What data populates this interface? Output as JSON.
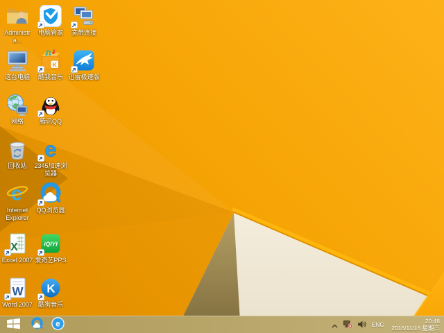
{
  "desktop": {
    "icons": [
      {
        "name": "user-folder",
        "label": "Administra...",
        "shortcut": false
      },
      {
        "name": "pc-manager",
        "label": "电脑管家",
        "shortcut": true
      },
      {
        "name": "broadband",
        "label": "宽带连接",
        "shortcut": true
      },
      {
        "name": "this-pc",
        "label": "这台电脑",
        "shortcut": false
      },
      {
        "name": "kuwo-music",
        "label": "酷我音乐",
        "shortcut": true
      },
      {
        "name": "xunlei",
        "label": "迅雷极速版",
        "shortcut": true
      },
      {
        "name": "network",
        "label": "网络",
        "shortcut": false
      },
      {
        "name": "tencent-qq",
        "label": "腾讯QQ",
        "shortcut": true
      },
      {
        "name": "recycle-bin",
        "label": "回收站",
        "shortcut": false
      },
      {
        "name": "2345-browser",
        "label": "2345加速浏\n览器",
        "shortcut": true
      },
      {
        "name": "internet-explorer",
        "label": "Internet\nExplorer",
        "shortcut": false
      },
      {
        "name": "qq-browser",
        "label": "QQ浏览器",
        "shortcut": true
      },
      {
        "name": "excel-2007",
        "label": "Excel 2007",
        "shortcut": true
      },
      {
        "name": "iqiyi-pps",
        "label": "爱奇艺PPS",
        "shortcut": true
      },
      {
        "name": "word-2007",
        "label": "Word 2007",
        "shortcut": true
      },
      {
        "name": "kugou-music",
        "label": "酷狗音乐",
        "shortcut": true
      }
    ]
  },
  "taskbar": {
    "app_icons": [
      "start",
      "qq-browser",
      "2345-browser"
    ],
    "tray": {
      "expand_icon": "chevron-up",
      "network_status": "disconnected",
      "language": "ENG",
      "time": "20:48",
      "date": "2016/11/16 星期三"
    }
  },
  "colors": {
    "wallpaper_orange_bright": "#FCB117",
    "wallpaper_orange_deep": "#E99200",
    "wallpaper_cream": "#F2EBD9",
    "wallpaper_khaki": "#A8914F",
    "taskbar_tan": "#B7A468",
    "tray_icon_dark": "#4C3F22"
  }
}
